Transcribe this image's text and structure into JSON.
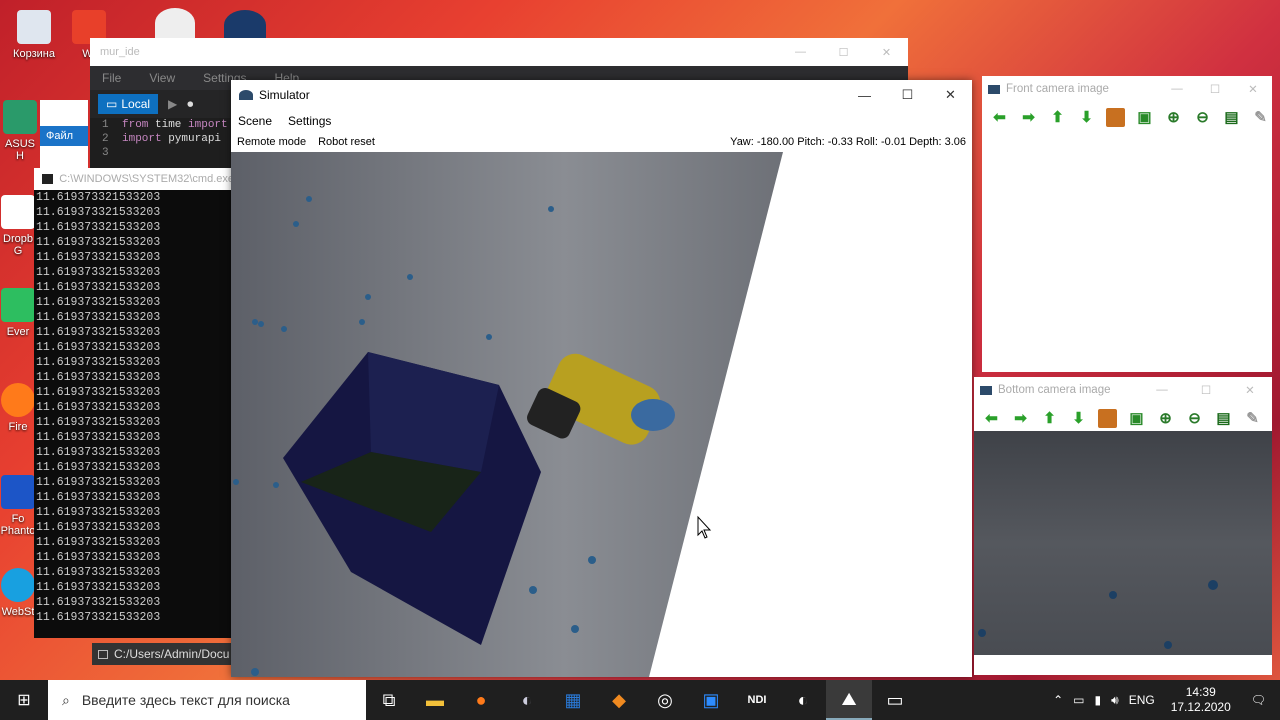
{
  "desktop": {
    "icons": [
      {
        "label": "Корзина"
      },
      {
        "label": "WI"
      },
      {
        "label": "ASUS H"
      },
      {
        "label": "Dropb G"
      },
      {
        "label": "Ever"
      },
      {
        "label": "Fire"
      },
      {
        "label": "Fo Phanto"
      },
      {
        "label": "WebSt"
      }
    ]
  },
  "ide": {
    "title": "mur_ide",
    "menu": [
      "File",
      "View",
      "Settings",
      "Help"
    ],
    "local_label": "Local",
    "code": [
      {
        "n": "1",
        "a": "from",
        "b": " time ",
        "c": "import"
      },
      {
        "n": "2",
        "a": "import",
        "b": " pymurapi",
        "c": ""
      },
      {
        "n": "3",
        "a": "",
        "b": "",
        "c": ""
      }
    ],
    "tab_label": "Файл"
  },
  "terminal": {
    "title": "C:\\WINDOWS\\SYSTEM32\\cmd.exe",
    "line": "11.619373321533203",
    "line_count": 29,
    "path": "C:/Users/Admin/Docu"
  },
  "simulator": {
    "title": "Simulator",
    "menu": [
      "Scene",
      "Settings"
    ],
    "remote_mode": "Remote mode",
    "robot_reset": "Robot reset",
    "telemetry": "Yaw: -180.00 Pitch: -0.33 Roll: -0.01 Depth: 3.06"
  },
  "front_camera": {
    "title": "Front camera image"
  },
  "bottom_camera": {
    "title": "Bottom camera image"
  },
  "taskbar": {
    "search_placeholder": "Введите здесь текст для поиска",
    "lang": "ENG",
    "time": "14:39",
    "date": "17.12.2020"
  }
}
